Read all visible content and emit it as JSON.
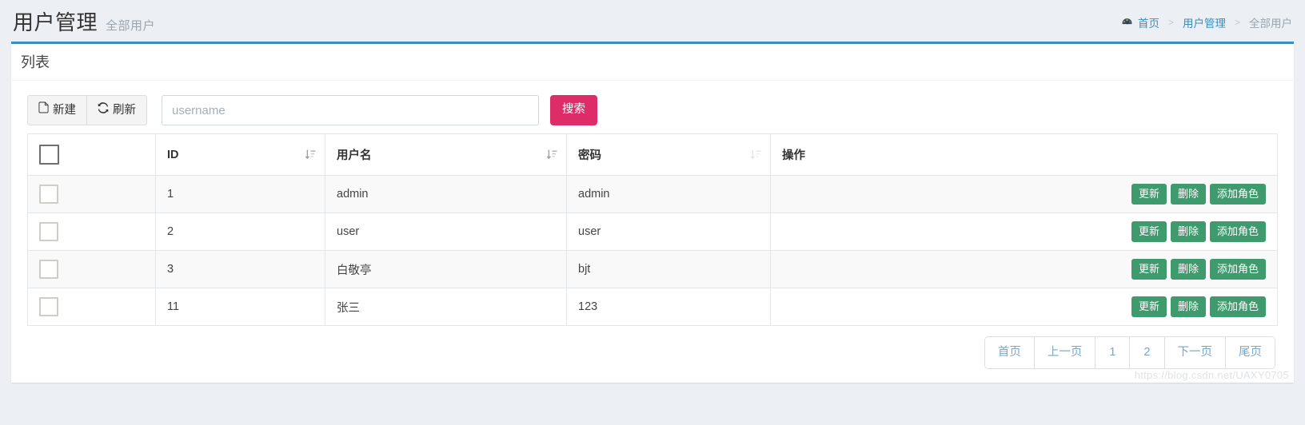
{
  "header": {
    "title": "用户管理",
    "subtitle": "全部用户",
    "breadcrumb": {
      "home_icon": "dashboard-icon",
      "home": "首页",
      "sep": ">",
      "level2": "用户管理",
      "level3": "全部用户"
    }
  },
  "box": {
    "title": "列表"
  },
  "toolbar": {
    "new_label": "新建",
    "new_icon": "file-icon",
    "refresh_label": "刷新",
    "refresh_icon": "refresh-icon",
    "search_placeholder": "username",
    "search_value": "",
    "search_button": "搜索"
  },
  "table": {
    "columns": [
      {
        "label": "",
        "sortable": false
      },
      {
        "label": "ID",
        "sortable": true
      },
      {
        "label": "用户名",
        "sortable": true
      },
      {
        "label": "密码",
        "sortable": true
      },
      {
        "label": "操作",
        "sortable": false
      }
    ],
    "rows": [
      {
        "id": "1",
        "username": "admin",
        "password": "admin"
      },
      {
        "id": "2",
        "username": "user",
        "password": "user"
      },
      {
        "id": "3",
        "username": "白敬亭",
        "password": "bjt"
      },
      {
        "id": "11",
        "username": "张三",
        "password": "123"
      }
    ],
    "row_actions": {
      "update": "更新",
      "delete": "删除",
      "add_role": "添加角色"
    }
  },
  "pagination": {
    "first": "首页",
    "prev": "上一页",
    "pages": [
      "1",
      "2"
    ],
    "next": "下一页",
    "last": "尾页"
  },
  "watermark": "https://blog.csdn.net/UAXY0705",
  "colors": {
    "accent": "#3c8dbc",
    "search_button": "#dd2c68",
    "action_button": "#3f9a6d",
    "page_background": "#ecf0f5",
    "link": "#3c8dbc"
  }
}
